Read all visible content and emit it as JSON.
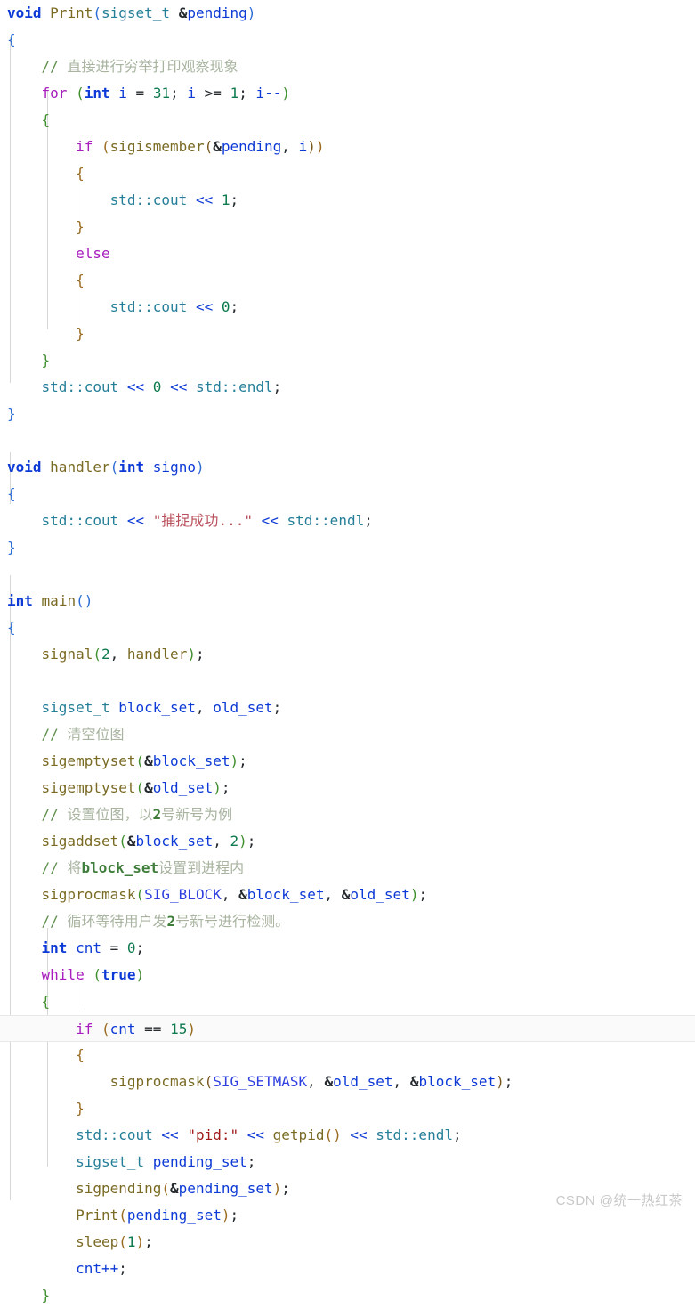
{
  "editor": {
    "language": "cpp",
    "background": "#ffffff",
    "highlight_line_number": 36,
    "line_height_px": 30,
    "font_size_px": 16,
    "theme_colors": {
      "keyword": "#a71dbd",
      "type_keyword": "#0d3ad6",
      "type_name": "#267f99",
      "function": "#7a6a24",
      "variable": "#0d3ad6",
      "number": "#0e7a4e",
      "comment": "#a8b4a0",
      "comment_code": "#3f7d3a",
      "string_cjk": "#b9505c",
      "string_ascii": "#a01a1a",
      "macro": "#2f3fdf",
      "bracket_depth0": "#2b6cd4",
      "bracket_depth1": "#3f8f2e",
      "bracket_depth2": "#9a6a1f",
      "current_line_bg": "#fafafa",
      "indent_guide": "#d7d7d7"
    }
  },
  "code": {
    "lines": [
      "void Print(sigset_t &pending)",
      "{",
      "    // 直接进行穷举打印观察现象",
      "    for (int i = 31; i >= 1; i--)",
      "    {",
      "        if (sigismember(&pending, i))",
      "        {",
      "            std::cout << 1;",
      "        }",
      "        else",
      "        {",
      "            std::cout << 0;",
      "        }",
      "    }",
      "    std::cout << 0 << std::endl;",
      "}",
      "",
      "void handler(int signo)",
      "{",
      "    std::cout << \"捕捉成功...\" << std::endl;",
      "}",
      "",
      "int main()",
      "{",
      "    signal(2, handler);",
      "",
      "    sigset_t block_set, old_set;",
      "    // 清空位图",
      "    sigemptyset(&block_set);",
      "    sigemptyset(&old_set);",
      "    // 设置位图，以2号新号为例",
      "    sigaddset(&block_set, 2);",
      "    // 将block_set设置到进程内",
      "    sigprocmask(SIG_BLOCK, &block_set, &old_set);",
      "    // 循环等待用户发2号新号进行检测。",
      "    int cnt = 0;",
      "    while (true)",
      "    {",
      "        if (cnt == 15)",
      "        {",
      "            sigprocmask(SIG_SETMASK, &old_set, &block_set);",
      "        }",
      "        std::cout << \"pid:\" << getpid() << std::endl;",
      "        sigset_t pending_set;",
      "        sigpending(&pending_set);",
      "        Print(pending_set);",
      "        sleep(1);",
      "        cnt++;",
      "    }"
    ]
  },
  "watermark": {
    "text": "CSDN @统一热红茶"
  }
}
